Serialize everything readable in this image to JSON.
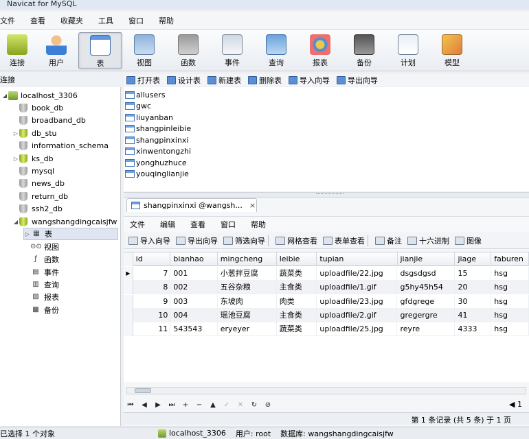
{
  "window": {
    "title": "Navicat for MySQL"
  },
  "menu": [
    "文件",
    "查看",
    "收藏夹",
    "工具",
    "窗口",
    "帮助"
  ],
  "toolbar": [
    {
      "label": "连接",
      "icon": "connection-icon",
      "active": false
    },
    {
      "label": "用户",
      "icon": "user-icon",
      "active": false
    },
    {
      "label": "表",
      "icon": "table-icon",
      "active": true
    },
    {
      "label": "视图",
      "icon": "view-icon",
      "active": false
    },
    {
      "label": "函数",
      "icon": "function-icon",
      "active": false
    },
    {
      "label": "事件",
      "icon": "event-icon",
      "active": false
    },
    {
      "label": "查询",
      "icon": "query-icon",
      "active": false
    },
    {
      "label": "报表",
      "icon": "report-icon",
      "active": false
    },
    {
      "label": "备份",
      "icon": "backup-icon",
      "active": false
    },
    {
      "label": "计划",
      "icon": "schedule-icon",
      "active": false
    },
    {
      "label": "模型",
      "icon": "model-icon",
      "active": false
    }
  ],
  "left_pane_label": "连接",
  "tree": {
    "server": "localhost_3306",
    "databases": [
      {
        "name": "book_db",
        "open": false,
        "expandable": false
      },
      {
        "name": "broadband_db",
        "open": false,
        "expandable": false
      },
      {
        "name": "db_stu",
        "open": true,
        "expandable": true
      },
      {
        "name": "information_schema",
        "open": false,
        "expandable": false
      },
      {
        "name": "ks_db",
        "open": true,
        "expandable": true
      },
      {
        "name": "mysql",
        "open": false,
        "expandable": false
      },
      {
        "name": "news_db",
        "open": false,
        "expandable": false
      },
      {
        "name": "return_db",
        "open": false,
        "expandable": false
      },
      {
        "name": "ssh2_db",
        "open": false,
        "expandable": false
      },
      {
        "name": "wangshangdingcaisjfw",
        "open": true,
        "expandable": true
      }
    ],
    "sub_items": [
      "表",
      "视图",
      "函数",
      "事件",
      "查询",
      "报表",
      "备份"
    ]
  },
  "object_toolbar": [
    "打开表",
    "设计表",
    "新建表",
    "删除表",
    "导入向导",
    "导出向导"
  ],
  "tables": [
    "allusers",
    "gwc",
    "liuyanban",
    "shangpinleibie",
    "shangpinxinxi",
    "xinwentongzhi",
    "yonghuzhuce",
    "youqinglianjie"
  ],
  "data_window": {
    "tab_title": "shangpinxinxi @wangsh...",
    "tab_close": "×",
    "menu": [
      "文件",
      "编辑",
      "查看",
      "窗口",
      "帮助"
    ],
    "toolbar": [
      "导入向导",
      "导出向导",
      "筛选向导",
      "网格查看",
      "表单查看",
      "备注",
      "十六进制",
      "图像"
    ],
    "columns": [
      "id",
      "bianhao",
      "mingcheng",
      "leibie",
      "tupian",
      "jianjie",
      "jiage",
      "faburen"
    ],
    "rows": [
      [
        "7",
        "001",
        "小葱拌豆腐",
        "蔬菜类",
        "uploadfile/22.jpg",
        "dsgsdgsd",
        "15",
        "hsg"
      ],
      [
        "8",
        "002",
        "五谷杂粮",
        "主食类",
        "uploadfile/1.gif",
        "g5hy45h54",
        "20",
        "hsg"
      ],
      [
        "9",
        "003",
        "东坡肉",
        "肉类",
        "uploadfile/23.jpg",
        "gfdgrege",
        "30",
        "hsg"
      ],
      [
        "10",
        "004",
        "瑶池豆腐",
        "主食类",
        "uploadfile/2.gif",
        "gregergre",
        "41",
        "hsg"
      ],
      [
        "11",
        "543543",
        "eryeyer",
        "蔬菜类",
        "uploadfile/25.jpg",
        "reyre",
        "4333",
        "hsg"
      ]
    ],
    "nav_buttons": [
      "⏮",
      "◀",
      "▶",
      "⏭",
      "+",
      "−",
      "▲",
      "✓",
      "✕",
      "↻",
      "⊘"
    ],
    "nav_right": "◀ 1",
    "record_status": "第 1 条记录 (共 5 条) 于 1 页"
  },
  "statusbar": {
    "selection": "已选择 1 个对象",
    "connection": "localhost_3306",
    "user": "用户: root",
    "database": "数据库: wangshangdingcaisjfw"
  }
}
